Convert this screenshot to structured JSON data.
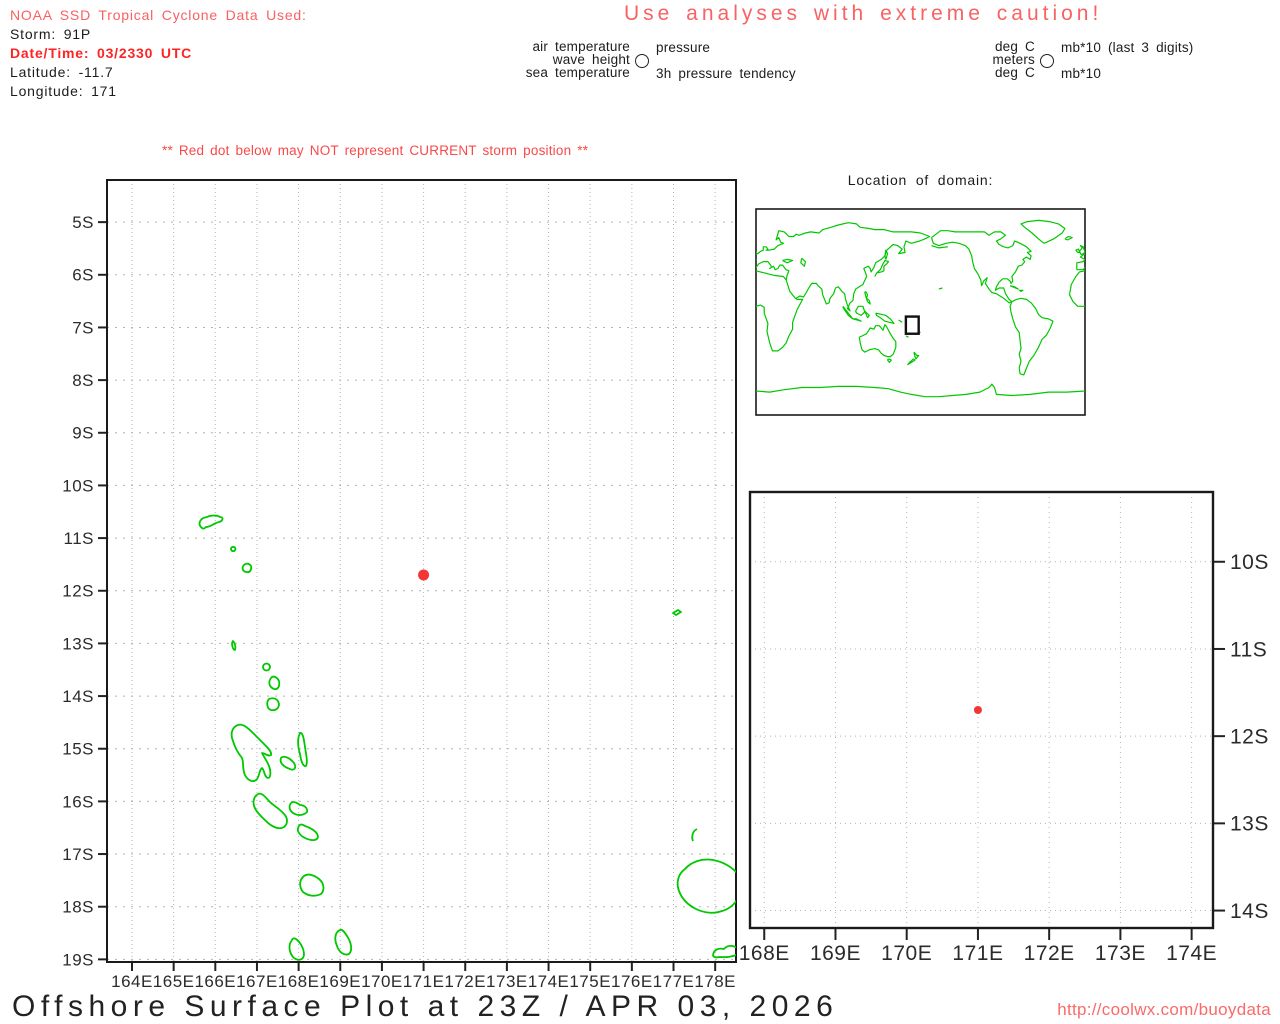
{
  "header": {
    "noaa_line": "NOAA SSD Tropical Cyclone Data Used:",
    "storm_line": "Storm: 91P",
    "datetime_line": "Date/Time: 03/2330 UTC",
    "latitude_line": "Latitude: -11.7",
    "longitude_line": "Longitude: 171"
  },
  "caution_title": "Use analyses with extreme caution!",
  "station_legend": {
    "variables": {
      "left": [
        "air temperature",
        "wave height",
        "sea temperature"
      ],
      "right": [
        "pressure",
        "3h pressure tendency"
      ]
    },
    "units": {
      "left": [
        "deg C",
        "meters",
        "deg C"
      ],
      "right": [
        "mb*10 (last 3 digits)",
        "mb*10"
      ]
    }
  },
  "warning_line": "** Red dot below may NOT represent CURRENT storm position **",
  "footer": {
    "title": "Offshore Surface Plot at 23Z / APR 03, 2026",
    "url": "http://coolwx.com/buoydata"
  },
  "colors": {
    "salmon_text": "#fa6060",
    "datetime_red": "#ff2424",
    "warning_red": "#fb4848",
    "coastline_green": "#00c800",
    "storm_dot_red": "#f23636",
    "grid_gray": "#b4b4b4",
    "border_black": "#1a1a1a"
  },
  "chart_data": [
    {
      "type": "scatter",
      "name": "main_map",
      "x_ticks": [
        "164E",
        "165E",
        "166E",
        "167E",
        "168E",
        "169E",
        "170E",
        "171E",
        "172E",
        "173E",
        "174E",
        "175E",
        "176E",
        "177E",
        "178E"
      ],
      "y_ticks": [
        "5S",
        "6S",
        "7S",
        "8S",
        "9S",
        "10S",
        "11S",
        "12S",
        "13S",
        "14S",
        "15S",
        "16S",
        "17S",
        "18S",
        "19S"
      ],
      "xlim_deg_east": [
        163.4,
        178.5
      ],
      "ylim_deg_south": [
        4.2,
        19.05
      ],
      "grid": true,
      "points": [
        {
          "lon_e": 171,
          "lat": -11.7,
          "color": "#f23636",
          "label": "storm 91P position (red dot)"
        }
      ],
      "features": [
        "Vanuatu island chain (green coastline outlines)",
        "Fiji (bottom right, green outlines)"
      ]
    },
    {
      "type": "scatter",
      "name": "zoom_inset_map",
      "x_ticks": [
        "168E",
        "169E",
        "170E",
        "171E",
        "172E",
        "173E",
        "174E"
      ],
      "y_ticks": [
        "10S",
        "11S",
        "12S",
        "13S",
        "14S"
      ],
      "xlim_deg_east": [
        167.8,
        174.3
      ],
      "ylim_deg_south": [
        9.2,
        14.2
      ],
      "grid": true,
      "y_labels_side": "right",
      "points": [
        {
          "lon_e": 171,
          "lat": -11.7,
          "color": "#f23636",
          "label": "storm 91P position (red dot)"
        }
      ]
    },
    {
      "type": "map",
      "name": "world_locator",
      "title": "Location of domain:",
      "domain_box_lon_e": [
        164,
        178
      ],
      "domain_box_lat": [
        -19,
        -4
      ]
    }
  ]
}
